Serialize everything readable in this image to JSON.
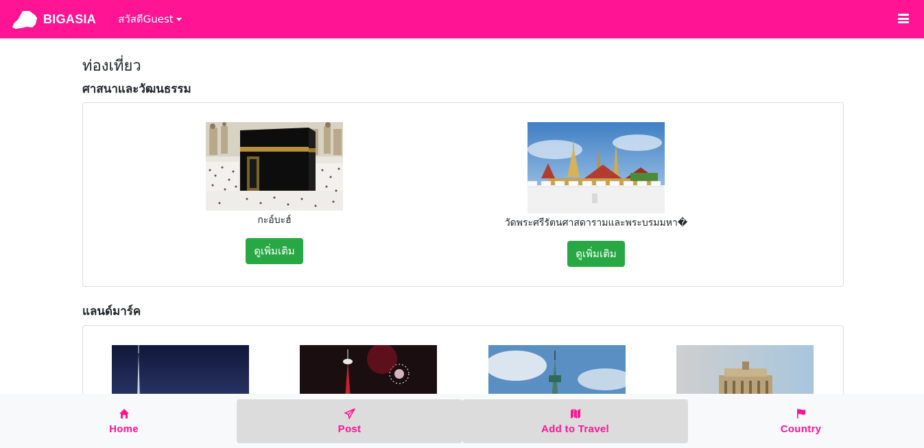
{
  "header": {
    "brand": "BIGASIA",
    "greeting": "สวัสดีGuest"
  },
  "page": {
    "title": "ท่องเที่ยว"
  },
  "sections": [
    {
      "title": "ศาสนาและวัฒนธรรม",
      "items": [
        {
          "label": "กะอ์บะฮ์",
          "button": "ดูเพิ่มเติม"
        },
        {
          "label": "วัดพระศรีรัตนศาสดารามและพระบรมมหา�",
          "button": "ดูเพิ่มเติม"
        }
      ]
    },
    {
      "title": "แลนด์มาร์ค",
      "items": [
        {
          "label": ""
        },
        {
          "label": ""
        },
        {
          "label": ""
        },
        {
          "label": ""
        }
      ]
    }
  ],
  "bottom_nav": [
    {
      "label": "Home",
      "icon": "home-icon"
    },
    {
      "label": "Post",
      "icon": "paper-plane-icon"
    },
    {
      "label": "Add to Travel",
      "icon": "map-icon"
    },
    {
      "label": "Country",
      "icon": "flag-icon"
    }
  ],
  "colors": {
    "primary": "#ff1493",
    "button": "#28a745",
    "nav_active": "#dcdcdc"
  }
}
